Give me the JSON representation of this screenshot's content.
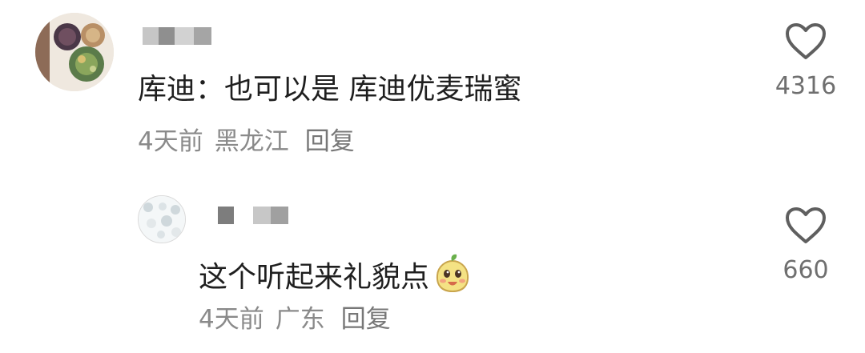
{
  "comments": [
    {
      "text": "库迪：也可以是 库迪优麦瑞蜜",
      "time": "4天前",
      "location": "黑龙江",
      "reply_label": "回复",
      "likes": "4316",
      "icons": {
        "avatar": "food-bowls-avatar",
        "like": "heart-outline-icon"
      }
    },
    {
      "text": "这个听起来礼貌点",
      "time": "4天前",
      "location": "广东",
      "reply_label": "回复",
      "likes": "660",
      "icons": {
        "avatar": "pattern-avatar",
        "like": "heart-outline-icon",
        "emoji": "smiling-mascot-emoji"
      }
    }
  ],
  "colors": {
    "text": "#1f1f1f",
    "meta": "#8a8a8a",
    "like_count": "#6f6f6f",
    "heart_stroke": "#5f5f5f"
  }
}
